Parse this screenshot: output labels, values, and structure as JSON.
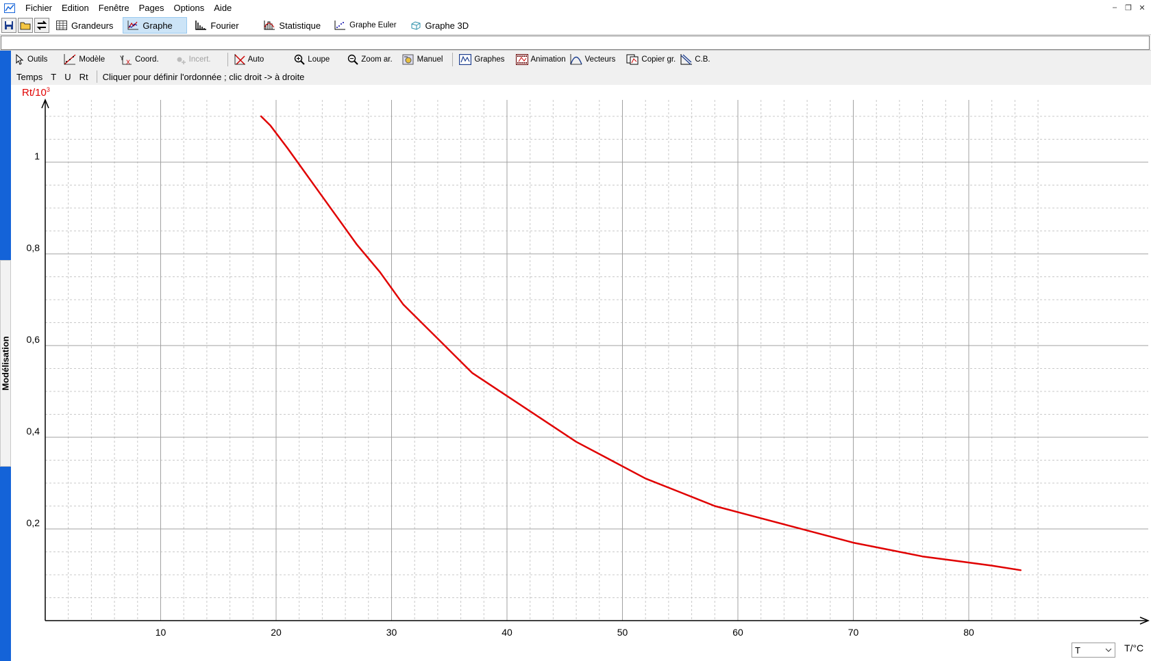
{
  "menubar": {
    "items": [
      "Fichier",
      "Edition",
      "Fenêtre",
      "Pages",
      "Options",
      "Aide"
    ]
  },
  "tabs": [
    {
      "label": "Grandeurs",
      "icon": "table-icon",
      "active": false
    },
    {
      "label": "Graphe",
      "icon": "graph-icon",
      "active": true
    },
    {
      "label": "Fourier",
      "icon": "spectrum-icon",
      "active": false
    },
    {
      "label": "Statistique",
      "icon": "histogram-icon",
      "active": false
    },
    {
      "label": "Graphe Euler",
      "icon": "scatter-icon",
      "active": false
    },
    {
      "label": "Graphe 3D",
      "icon": "cube-icon",
      "active": false
    }
  ],
  "toolbar": {
    "outils": "Outils",
    "modele": "Modèle",
    "coord": "Coord.",
    "incert": "Incert.",
    "auto": "Auto",
    "loupe": "Loupe",
    "zoom_ar": "Zoom ar.",
    "manuel": "Manuel",
    "graphes": "Graphes",
    "animation": "Animation",
    "vecteurs": "Vecteurs",
    "copier": "Copier gr.",
    "cb": "C.B."
  },
  "hintbar": {
    "vars": [
      "Temps",
      "T",
      "U",
      "Rt"
    ],
    "hint": "Cliquer pour définir l'ordonnée ; clic droit -> à droite"
  },
  "sidetab": {
    "label": "Modélisation"
  },
  "axis": {
    "ylabel_main": "Rt/10",
    "ylabel_exp": "3",
    "xunit": "T/°C",
    "xselect_value": "T"
  },
  "colors": {
    "curve": "#e00000",
    "sidebar": "#1463d8",
    "active_tab": "#cce4f7"
  },
  "chart_data": {
    "type": "line",
    "xlabel": "T/°C",
    "ylabel": "Rt/10³",
    "xlim": [
      0,
      84
    ],
    "ylim": [
      0,
      1.15
    ],
    "xticks": [
      10,
      20,
      30,
      40,
      50,
      60,
      70,
      80
    ],
    "xtick_labels": [
      "10",
      "20",
      "30",
      "40",
      "50",
      "60",
      "70",
      "80"
    ],
    "yticks": [
      0.2,
      0.4,
      0.6,
      0.8,
      1
    ],
    "ytick_labels": [
      "0,2",
      "0,4",
      "0,6",
      "0,8",
      "1"
    ],
    "grid": true,
    "series": [
      {
        "x": [
          18.7,
          19.5,
          21,
          23,
          25,
          27,
          29,
          31,
          33,
          35,
          37,
          40,
          43,
          46,
          49,
          52,
          55,
          58,
          61,
          64,
          67,
          70,
          73,
          76,
          79,
          82,
          84.5
        ],
        "values": [
          1.1,
          1.08,
          1.03,
          0.96,
          0.89,
          0.82,
          0.76,
          0.69,
          0.64,
          0.59,
          0.54,
          0.49,
          0.44,
          0.39,
          0.35,
          0.31,
          0.28,
          0.25,
          0.23,
          0.21,
          0.19,
          0.17,
          0.155,
          0.14,
          0.13,
          0.12,
          0.11
        ]
      }
    ]
  }
}
